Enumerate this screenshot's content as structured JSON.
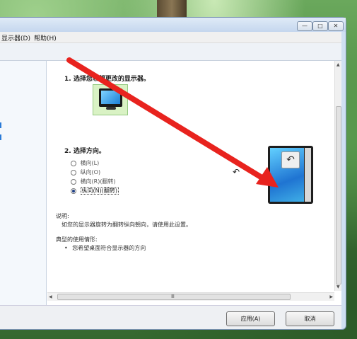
{
  "menubar": {
    "display": "显示器(D)",
    "help": "帮助(H)"
  },
  "window_controls": {
    "minimize": "—",
    "maximize": "□",
    "close": "✕"
  },
  "step1": {
    "title": "1. 选择您希望更改的显示器。"
  },
  "step2": {
    "title": "2. 选择方向。",
    "options": [
      {
        "label": "横向(L)",
        "selected": false
      },
      {
        "label": "纵向(O)",
        "selected": false
      },
      {
        "label": "横向(R)(翻转)",
        "selected": false
      },
      {
        "label": "纵向(N)(翻转)",
        "selected": true
      }
    ]
  },
  "description": {
    "heading": "说明:",
    "text": "如您的显示器旋转为翻转纵向朝向，请使用此设置。"
  },
  "typical_use": {
    "heading": "典型的使用情形:",
    "items": [
      "您希望桌面符合显示器的方向"
    ]
  },
  "scroll_grip": "Ⅲ",
  "buttons": {
    "apply": "应用(A)",
    "cancel": "取消"
  },
  "icons": {
    "rotate": "↶",
    "rotate_small": "↶",
    "bullet": "•"
  },
  "colors": {
    "arrow": "#e8231e",
    "selected_monitor_bg": "#d9f2c4"
  }
}
